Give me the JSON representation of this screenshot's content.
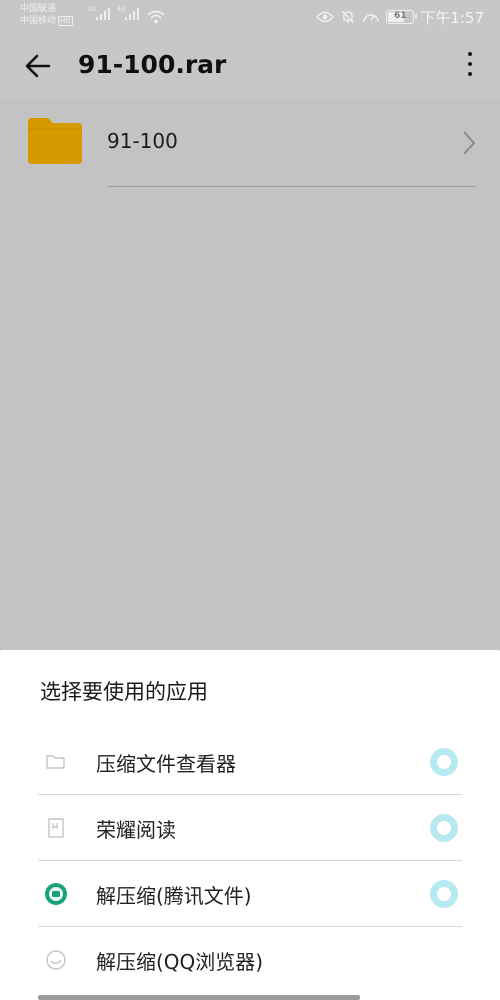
{
  "status_bar": {
    "carrier_1": "中国联通",
    "carrier_2": "中国移动",
    "carrier_2_badge": "HD",
    "signal_1_tag": "2G",
    "signal_2_tag": "4G",
    "battery_level": "61",
    "time": "下午1:57",
    "icons": [
      "eye-icon",
      "bell-off-icon",
      "speed-icon",
      "battery-icon",
      "wifi-icon",
      "signal-icon"
    ]
  },
  "app_bar": {
    "title": "91-100.rar",
    "icons": [
      "back-arrow-icon",
      "more-vert-icon"
    ]
  },
  "file_list": [
    {
      "name": "91-100",
      "icon": "folder-icon",
      "color": "#d49a00"
    }
  ],
  "sheet": {
    "title": "选择要使用的应用",
    "options": [
      {
        "label": "压缩文件查看器",
        "icon": "folder-outline-icon"
      },
      {
        "label": "荣耀阅读",
        "icon": "book-icon"
      },
      {
        "label": "解压缩(腾讯文件)",
        "icon": "tencent-file-icon"
      },
      {
        "label": "解压缩(QQ浏览器)",
        "icon": "qq-browser-icon"
      }
    ],
    "radio_color": "#b7e9f1"
  }
}
